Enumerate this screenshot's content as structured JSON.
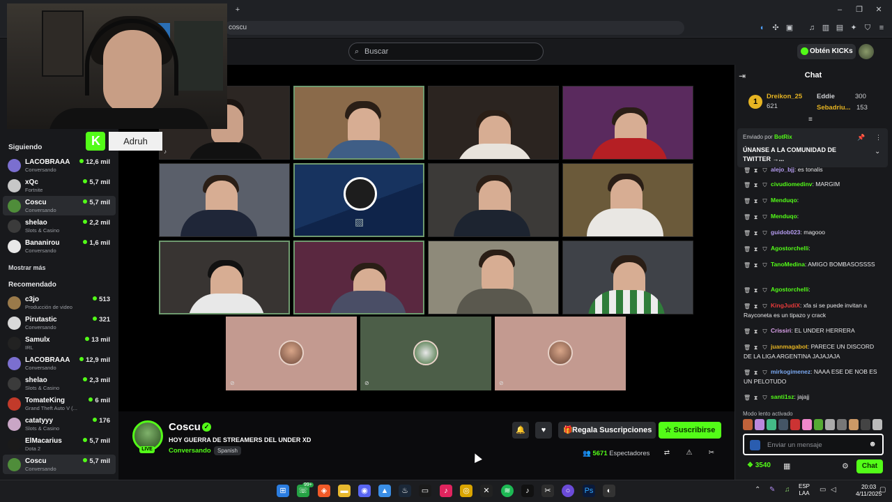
{
  "browser": {
    "url": "coscu",
    "new_tab": "+",
    "window_controls": [
      "–",
      "❐",
      "✕"
    ]
  },
  "header": {
    "search_placeholder": "Buscar",
    "get_kicks": "Obtén KICKs"
  },
  "overlay": {
    "username": "Adruh",
    "badge_letter": "K"
  },
  "sidebar": {
    "following_title": "Siguiendo",
    "following": [
      {
        "name": "LACOBRAAA",
        "category": "Conversando",
        "viewers": "12,6 mil",
        "color": "#7b6fd0"
      },
      {
        "name": "xQc",
        "category": "Fortnite",
        "viewers": "5,7 mil",
        "color": "#c7c7c7"
      },
      {
        "name": "Coscu",
        "category": "Conversando",
        "viewers": "5,7 mil",
        "color": "#4f8d3a"
      },
      {
        "name": "shelao",
        "category": "Slots & Casino",
        "viewers": "2,2 mil",
        "color": "#3b3b3b"
      },
      {
        "name": "Bananirou",
        "category": "Conversando",
        "viewers": "1,6 mil",
        "color": "#e8e8e8"
      }
    ],
    "show_more": "Mostrar más",
    "recommended_title": "Recomendado",
    "recommended": [
      {
        "name": "c3jo",
        "category": "Producción de video",
        "viewers": "513",
        "color": "#9a7a4a"
      },
      {
        "name": "Pirutastic",
        "category": "Conversando",
        "viewers": "321",
        "color": "#d9d9d9"
      },
      {
        "name": "Samulx",
        "category": "IRL",
        "viewers": "13 mil",
        "color": "#222222"
      },
      {
        "name": "LACOBRAAA",
        "category": "Conversando",
        "viewers": "12,9 mil",
        "color": "#7b6fd0"
      },
      {
        "name": "shelao",
        "category": "Slots & Casino",
        "viewers": "2,3 mil",
        "color": "#3b3b3b"
      },
      {
        "name": "TomateKing",
        "category": "Grand Theft Auto V (...",
        "viewers": "6 mil",
        "color": "#c23a2a"
      },
      {
        "name": "catatyyy",
        "category": "Slots & Casino",
        "viewers": "176",
        "color": "#c9a6c6"
      },
      {
        "name": "ElMacarius",
        "category": "Dota 2",
        "viewers": "5,7 mil",
        "color": "#1a1a1a"
      },
      {
        "name": "Coscu",
        "category": "Conversando",
        "viewers": "5,7 mil",
        "color": "#4f8d3a"
      }
    ]
  },
  "stream": {
    "streamer": "Coscu",
    "title": "HOY GUERRA DE STREAMERS DEL UNDER XD",
    "category": "Conversando",
    "language": "Spanish",
    "live": "LIVE",
    "gift_subs": "Regala Suscripciones",
    "subscribe": "Suscribirse",
    "viewers_count": "5671",
    "viewers_label": "Espectadores"
  },
  "chat": {
    "title": "Chat",
    "leaderboard": [
      {
        "name": "Dreikon_25",
        "value": "621",
        "color": "#e6b422"
      },
      {
        "name": "Eddie",
        "value": "300",
        "color": "#cfd1d4"
      },
      {
        "name": "Sebadriu...",
        "value": "153",
        "color": "#e6b422"
      }
    ],
    "leader_rank": "1",
    "pinned_by": "Enviado por",
    "pinned_user": "BotRix",
    "pinned_message": "ÚNANSE A LA COMUNIDAD DE TWITTER →...",
    "messages": [
      {
        "user": "alejo_bjj",
        "color": "#b59cf0",
        "text": ": es tonalis"
      },
      {
        "user": "civudiomedinv",
        "color": "#53fc18",
        "text": ": MARGIM"
      },
      {
        "user": "Menduqo",
        "color": "#53fc18",
        "text": ":"
      },
      {
        "user": "Menduqo",
        "color": "#53fc18",
        "text": ":"
      },
      {
        "user": "guidob023",
        "color": "#b59cf0",
        "text": ": magooo"
      },
      {
        "user": "Agostorchelli",
        "color": "#53fc18",
        "text": ":"
      },
      {
        "user": "TanoMedina",
        "color": "#53fc18",
        "text": ": AMIGO BOMBASOSSSS"
      },
      {
        "user": "Agostorchelli",
        "color": "#53fc18",
        "text": ":"
      },
      {
        "user": "KingJudiX",
        "color": "#e83a3a",
        "text": ": xfa si se puede invitan a Rayconeta es un tipazo y crack"
      },
      {
        "user": "Crissiri",
        "color": "#d9a0e8",
        "text": ": EL UNDER HERRERA"
      },
      {
        "user": "juanmagabot",
        "color": "#e6b422",
        "text": ": PARECE UN DISCORD DE LA LIGA ARGENTINA JAJAJAJA"
      },
      {
        "user": "mirkogimenez",
        "color": "#7aa8f0",
        "text": ": NAAA ESE DE NOB ES UN PELOTUDO"
      },
      {
        "user": "santi1sz",
        "color": "#53fc18",
        "text": ": jajajj"
      }
    ],
    "slow_mode": "Modo lento activado",
    "input_placeholder": "Enviar un mensaje",
    "points": "3540",
    "send_label": "Chat"
  },
  "taskbar": {
    "lang_top": "ESP",
    "lang_bottom": "LAA",
    "time": "20:03",
    "date": "4/11/2025",
    "badge_count": "99+"
  }
}
